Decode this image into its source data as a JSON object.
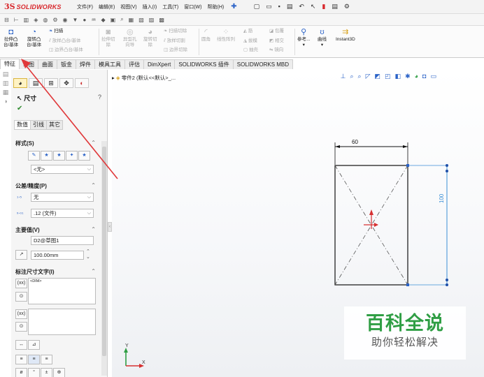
{
  "app": {
    "brand_ds": "3S",
    "brand_name": "SOLIDWORKS"
  },
  "menu": [
    "文件(F)",
    "编辑(E)",
    "视图(V)",
    "插入(I)",
    "工具(T)",
    "窗口(W)",
    "帮助(H)"
  ],
  "ribbon": {
    "extrude_boss": [
      "拉伸凸",
      "台/基体"
    ],
    "revolve_boss": [
      "旋转凸",
      "台/基体"
    ],
    "sweep": "扫描",
    "loft_boss": "放样凸台/基体",
    "boundary_boss": "边界凸台/基体",
    "extrude_cut": [
      "拉伸切",
      "除"
    ],
    "hole_wizard": [
      "异型孔",
      "向导"
    ],
    "revolve_cut": [
      "旋转切",
      "除"
    ],
    "swept_cut": "扫描切除",
    "lofted_cut": "放样切割",
    "boundary_cut": "边界切除",
    "fillet": "圆角",
    "linear_pattern": "线性阵列",
    "rib": "筋",
    "draft": "拔模",
    "shell": "抽壳",
    "wrap": "包覆",
    "intersect": "相交",
    "mirror": "镜向",
    "ref_geometry": "参考...",
    "curves": "曲线",
    "instant3d": "Instant3D"
  },
  "tabs": [
    "特征",
    "草图",
    "曲面",
    "钣金",
    "焊件",
    "模具工具",
    "评估",
    "DimXpert",
    "SOLIDWORKS 插件",
    "SOLIDWORKS MBD"
  ],
  "property_manager": {
    "title": "尺寸",
    "help": "?",
    "sub_tabs": [
      "数值",
      "引线",
      "其它"
    ],
    "style": {
      "label": "样式(S)",
      "value": "<无>"
    },
    "tolerance": {
      "label": "公差/精度(P)",
      "type_value": "无",
      "precision_value": ".12 (文件)"
    },
    "primary": {
      "label": "主要值(V)",
      "name": "D2@草图1",
      "value": "100.00mm"
    },
    "dim_text": {
      "label": "标注尺寸文字(I)",
      "dim_token": "<DIM>"
    }
  },
  "feature_tree": {
    "part": "零件2",
    "config": "(默认<<默认>_..."
  },
  "sketch": {
    "dim_width": "60",
    "dim_height": "100"
  },
  "watermark": {
    "line1": "百科全说",
    "line2": "助你轻松解决"
  },
  "colors": {
    "brand": "#d8262b",
    "accent": "#2a62c7",
    "dim_blue": "#3b8fd6",
    "watermark_green": "#2f9e44",
    "annotation_arrow": "#e0383a"
  }
}
